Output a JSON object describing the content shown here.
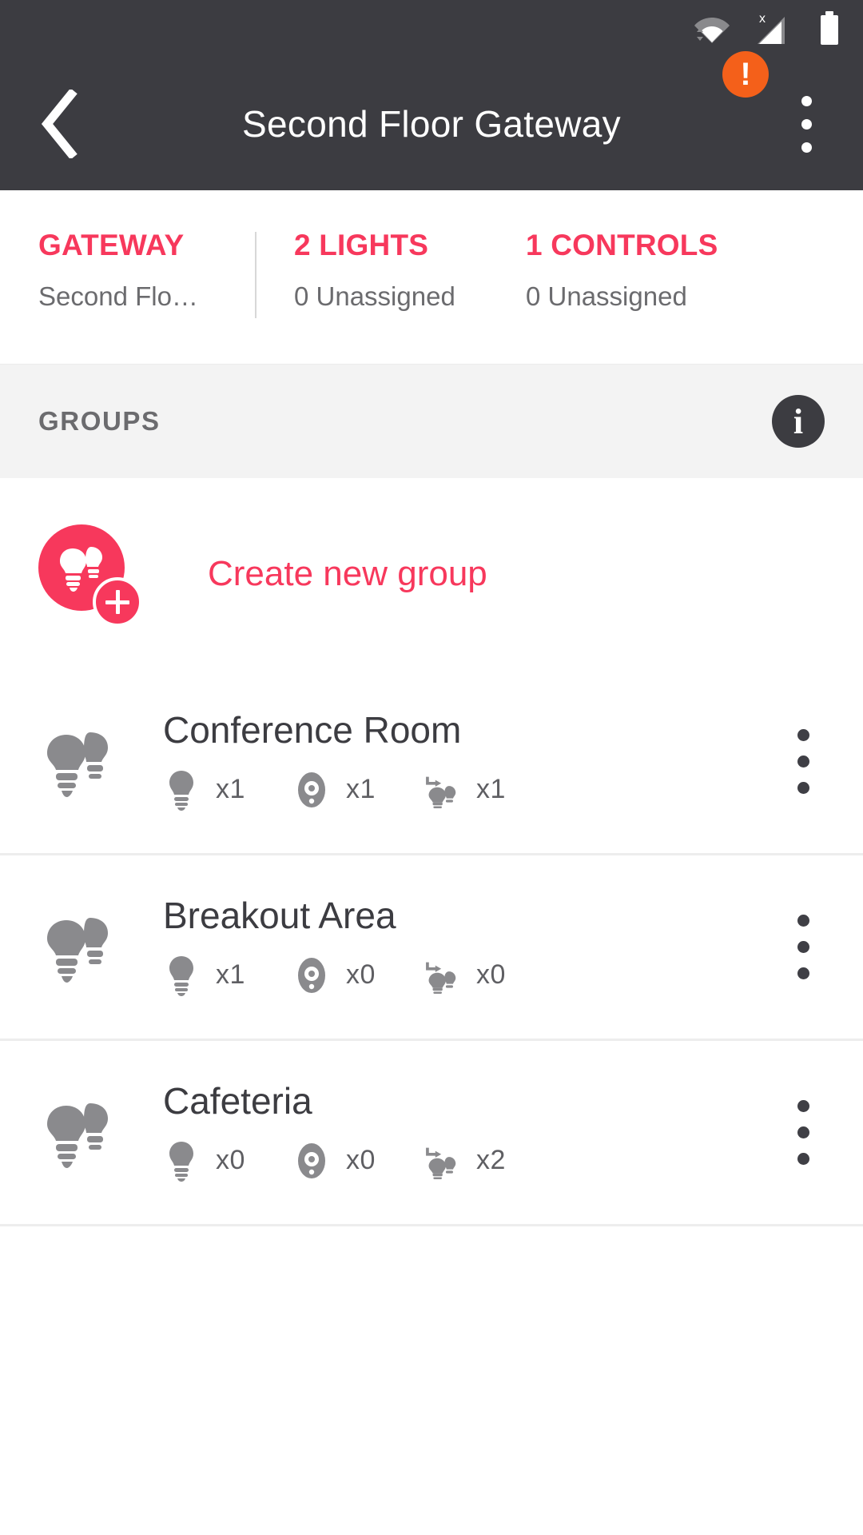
{
  "status_bar": {
    "wifi_icon": "wifi-icon",
    "cellular_icon": "cellular-signal-no-sim-icon",
    "cellular_badge": "x",
    "battery_icon": "battery-full-icon"
  },
  "app_bar": {
    "back_icon": "back-chevron-icon",
    "title": "Second Floor Gateway",
    "warning_icon": "warning-exclamation-icon",
    "warning_glyph": "!",
    "overflow_icon": "overflow-menu-icon"
  },
  "stats": [
    {
      "title": "GATEWAY",
      "subtitle": "Second Flo…"
    },
    {
      "title": "2 LIGHTS",
      "subtitle": "0 Unassigned"
    },
    {
      "title": "1 CONTROLS",
      "subtitle": "0 Unassigned"
    }
  ],
  "groups_header": {
    "label": "GROUPS",
    "info_icon": "info-icon",
    "info_glyph": "i"
  },
  "create_group": {
    "label": "Create new group",
    "icon": "two-bulbs-add-icon",
    "badge_icon": "plus-icon"
  },
  "groups": [
    {
      "name": "Conference Room",
      "icon": "two-bulbs-icon",
      "menu_icon": "overflow-menu-icon",
      "counts": [
        {
          "icon": "light-bulb-icon",
          "value": "x1"
        },
        {
          "icon": "rotary-control-icon",
          "value": "x1"
        },
        {
          "icon": "bulb-assign-icon",
          "value": "x1"
        }
      ]
    },
    {
      "name": "Breakout Area",
      "icon": "two-bulbs-icon",
      "menu_icon": "overflow-menu-icon",
      "counts": [
        {
          "icon": "light-bulb-icon",
          "value": "x1"
        },
        {
          "icon": "rotary-control-icon",
          "value": "x0"
        },
        {
          "icon": "bulb-assign-icon",
          "value": "x0"
        }
      ]
    },
    {
      "name": "Cafeteria",
      "icon": "two-bulbs-icon",
      "menu_icon": "overflow-menu-icon",
      "counts": [
        {
          "icon": "light-bulb-icon",
          "value": "x0"
        },
        {
          "icon": "rotary-control-icon",
          "value": "x0"
        },
        {
          "icon": "bulb-assign-icon",
          "value": "x2"
        }
      ]
    }
  ],
  "colors": {
    "accent": "#f7385c",
    "app_bar": "#3c3c41",
    "warning": "#f4601a",
    "section_bg": "#f3f3f3",
    "icon_gray": "#8a8a8d"
  }
}
